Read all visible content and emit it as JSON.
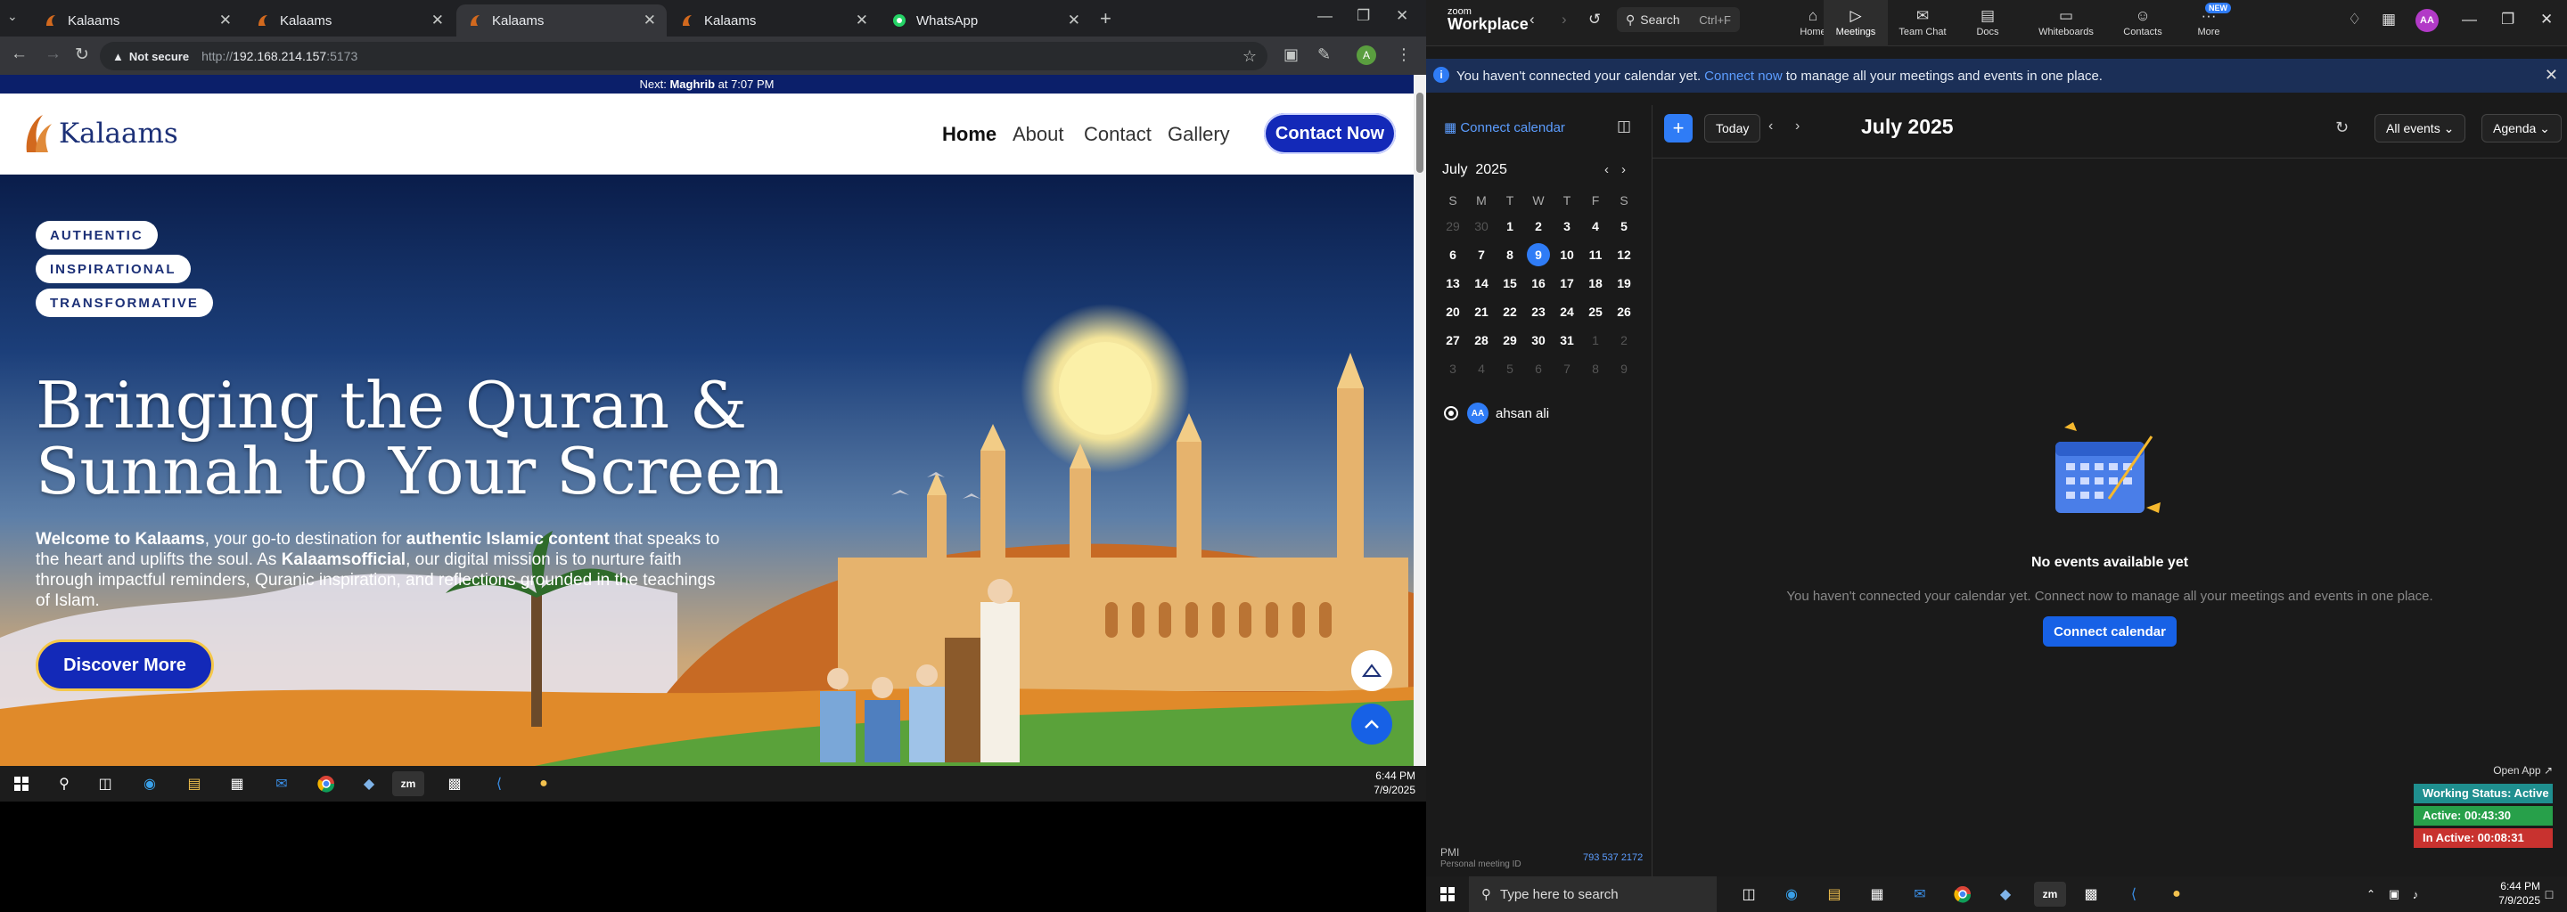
{
  "browser": {
    "tabs": [
      {
        "title": "Kalaams",
        "active": false
      },
      {
        "title": "Kalaams",
        "active": false
      },
      {
        "title": "Kalaams",
        "active": true
      },
      {
        "title": "Kalaams",
        "active": false
      },
      {
        "title": "WhatsApp",
        "active": false
      }
    ],
    "security_label": "Not secure",
    "url_prefix": "http://",
    "url_host": "192.168.214.157",
    "url_port": ":5173",
    "profile_initial": "A"
  },
  "site": {
    "announcement_prefix": "Next: ",
    "announcement_prayer": "Maghrib",
    "announcement_suffix": " at 7:07 PM",
    "logo_text": "Kalaams",
    "nav": [
      "Home",
      "About",
      "Contact",
      "Gallery"
    ],
    "contact_button": "Contact Now",
    "tags": [
      "AUTHENTIC",
      "INSPIRATIONAL",
      "TRANSFORMATIVE"
    ],
    "title_line1": "Bringing the Quran &",
    "title_line2": "Sunnah to Your Screen",
    "body": {
      "p1": "Welcome to Kalaams",
      "p2": ", your go-to destination for ",
      "p3": "authentic Islamic content",
      "p4": " that speaks to the heart and uplifts the soul. As ",
      "p5": "Kalaamsofficial",
      "p6": ", our digital mission is to nurture faith through impactful reminders, Quranic inspiration, and reflections grounded in the teachings of Islam."
    },
    "discover_button": "Discover More"
  },
  "taskbar_left": {
    "time": "6:44 PM",
    "date": "7/9/2025"
  },
  "zoom": {
    "logo_top": "zoom",
    "logo_bottom": "Workplace",
    "search_label": "Search",
    "search_shortcut": "Ctrl+F",
    "tabs": [
      {
        "label": "Home",
        "icon": "home-icon"
      },
      {
        "label": "Meetings",
        "icon": "video-icon"
      },
      {
        "label": "Team Chat",
        "icon": "chat-icon"
      },
      {
        "label": "Docs",
        "icon": "docs-icon"
      },
      {
        "label": "Whiteboards",
        "icon": "whiteboard-icon"
      },
      {
        "label": "Contacts",
        "icon": "contacts-icon"
      },
      {
        "label": "More",
        "icon": "more-icon"
      }
    ],
    "new_badge": "NEW",
    "avatar": "AA",
    "banner": {
      "text1": "You haven't connected your calendar yet.",
      "link": "Connect now",
      "text2": "to manage all your meetings and events in one place."
    },
    "connect_calendar_link": "Connect calendar",
    "mini_cal": {
      "month": "July",
      "year": "2025",
      "dows": [
        "S",
        "M",
        "T",
        "W",
        "T",
        "F",
        "S"
      ],
      "weeks": [
        [
          "29",
          "30",
          "1",
          "2",
          "3",
          "4",
          "5"
        ],
        [
          "6",
          "7",
          "8",
          "9",
          "10",
          "11",
          "12"
        ],
        [
          "13",
          "14",
          "15",
          "16",
          "17",
          "18",
          "19"
        ],
        [
          "20",
          "21",
          "22",
          "23",
          "24",
          "25",
          "26"
        ],
        [
          "27",
          "28",
          "29",
          "30",
          "31",
          "1",
          "2"
        ],
        [
          "3",
          "4",
          "5",
          "6",
          "7",
          "8",
          "9"
        ]
      ],
      "today": "9"
    },
    "user": {
      "initials": "AA",
      "name": "ahsan ali"
    },
    "toolbar": {
      "today": "Today",
      "title": "July 2025",
      "filter": "All events",
      "view": "Agenda"
    },
    "empty": {
      "title": "No events available yet",
      "subtitle": "You haven't connected your calendar yet. Connect now to manage all your meetings and events in one place.",
      "button": "Connect calendar"
    },
    "pmi": {
      "label": "PMI",
      "sub": "Personal meeting ID",
      "number": "793 537 2172"
    }
  },
  "status_widget": {
    "open_app": "Open App",
    "working": "Working Status: Active",
    "active": "Active: 00:43:30",
    "inactive": "In Active: 00:08:31",
    "colors": {
      "working": "#1f8f8f",
      "active": "#27a04a",
      "inactive": "#c8322f"
    }
  },
  "taskbar_right": {
    "search_placeholder": "Type here to search",
    "time": "6:44 PM",
    "date": "7/9/2025"
  }
}
